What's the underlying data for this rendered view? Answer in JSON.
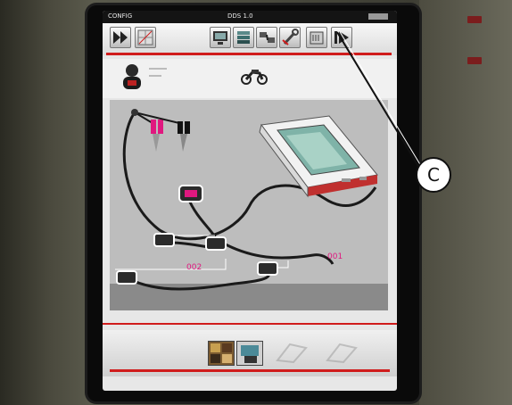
{
  "titlebar": {
    "left_text": "CONFIG",
    "center_text": "DDS 1.0"
  },
  "toolbar": {
    "buttons": [
      {
        "icon": "fast-forward-icon"
      },
      {
        "icon": "grid-icon"
      },
      {
        "icon": "monitor-icon"
      },
      {
        "icon": "stack-icon"
      },
      {
        "icon": "connection-icon"
      },
      {
        "icon": "wrench-icon"
      },
      {
        "icon": "manual-icon"
      },
      {
        "icon": "play-next-icon"
      }
    ]
  },
  "main": {
    "label_cable_1": "001",
    "label_cable_2": "002"
  },
  "footer": {
    "thumbnails": [
      {
        "icon": "photo-thumbnail-icon"
      },
      {
        "icon": "diagnostic-thumbnail-icon"
      },
      {
        "icon": "disabled-thumbnail-icon"
      },
      {
        "icon": "disabled-thumbnail-icon"
      }
    ]
  },
  "callout": {
    "label": "C"
  },
  "colors": {
    "accent_red": "#d01c1c",
    "screen_bg": "#e7e7e7",
    "diagram_bg": "#bdbdbd",
    "cable_magenta": "#e0187f"
  }
}
